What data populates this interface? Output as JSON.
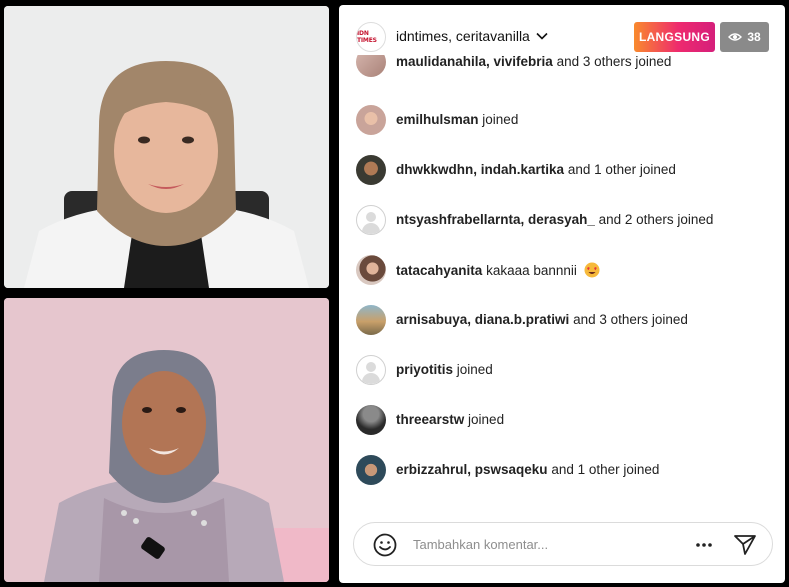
{
  "stream": {
    "host_logo_text": "IDN TIMES",
    "hosts": "idntimes, ceritavanilla",
    "live_label": "LANGSUNG",
    "viewer_count": "38"
  },
  "comments": [
    {
      "user": "maulidanahila, vivifebria",
      "msg": "and 3 others joined",
      "avatar": "photo-pink"
    },
    {
      "user": "emilhulsman",
      "msg": "joined",
      "avatar": "photo-hijab"
    },
    {
      "user": "dhwkkwdhn, indah.kartika",
      "msg": "and 1 other joined",
      "avatar": "photo-child"
    },
    {
      "user": "ntsyashfrabellarnta, derasyah_",
      "msg": "and 2 others joined",
      "avatar": "default"
    },
    {
      "user": "tatacahyanita",
      "msg": "kakaaa bannnii",
      "avatar": "photo-woman",
      "emoji": "heart-eyes"
    },
    {
      "user": "arnisabuya, diana.b.pratiwi",
      "msg": "and 3 others joined",
      "avatar": "photo-outdoor"
    },
    {
      "user": "priyotitis",
      "msg": "joined",
      "avatar": "default"
    },
    {
      "user": "threearstw",
      "msg": "joined",
      "avatar": "photo-dark"
    },
    {
      "user": "erbizzahrul, pswsaqeku",
      "msg": "and 1 other joined",
      "avatar": "photo-man"
    }
  ],
  "composer": {
    "placeholder": "Tambahkan komentar..."
  },
  "colors": {
    "live_gradient_start": "#f98a2d",
    "live_gradient_end": "#d51f7b",
    "viewer_badge": "#8a8a8a"
  }
}
